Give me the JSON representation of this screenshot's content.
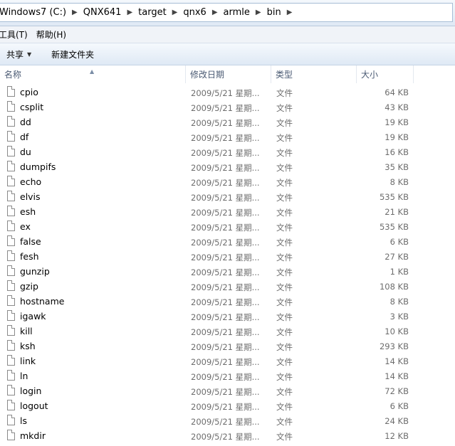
{
  "breadcrumb": [
    "Windows7 (C:)",
    "QNX641",
    "target",
    "qnx6",
    "armle",
    "bin"
  ],
  "menu": [
    "工具(T)",
    "帮助(H)"
  ],
  "toolbar": {
    "share": "共享",
    "new_folder": "新建文件夹"
  },
  "columns": {
    "name": "名称",
    "date": "修改日期",
    "type": "类型",
    "size": "大小"
  },
  "files": [
    {
      "name": "cpio",
      "date": "2009/5/21 星期...",
      "type": "文件",
      "size": "64 KB"
    },
    {
      "name": "csplit",
      "date": "2009/5/21 星期...",
      "type": "文件",
      "size": "43 KB"
    },
    {
      "name": "dd",
      "date": "2009/5/21 星期...",
      "type": "文件",
      "size": "19 KB"
    },
    {
      "name": "df",
      "date": "2009/5/21 星期...",
      "type": "文件",
      "size": "19 KB"
    },
    {
      "name": "du",
      "date": "2009/5/21 星期...",
      "type": "文件",
      "size": "16 KB"
    },
    {
      "name": "dumpifs",
      "date": "2009/5/21 星期...",
      "type": "文件",
      "size": "35 KB"
    },
    {
      "name": "echo",
      "date": "2009/5/21 星期...",
      "type": "文件",
      "size": "8 KB"
    },
    {
      "name": "elvis",
      "date": "2009/5/21 星期...",
      "type": "文件",
      "size": "535 KB"
    },
    {
      "name": "esh",
      "date": "2009/5/21 星期...",
      "type": "文件",
      "size": "21 KB"
    },
    {
      "name": "ex",
      "date": "2009/5/21 星期...",
      "type": "文件",
      "size": "535 KB"
    },
    {
      "name": "false",
      "date": "2009/5/21 星期...",
      "type": "文件",
      "size": "6 KB"
    },
    {
      "name": "fesh",
      "date": "2009/5/21 星期...",
      "type": "文件",
      "size": "27 KB"
    },
    {
      "name": "gunzip",
      "date": "2009/5/21 星期...",
      "type": "文件",
      "size": "1 KB"
    },
    {
      "name": "gzip",
      "date": "2009/5/21 星期...",
      "type": "文件",
      "size": "108 KB"
    },
    {
      "name": "hostname",
      "date": "2009/5/21 星期...",
      "type": "文件",
      "size": "8 KB"
    },
    {
      "name": "igawk",
      "date": "2009/5/21 星期...",
      "type": "文件",
      "size": "3 KB"
    },
    {
      "name": "kill",
      "date": "2009/5/21 星期...",
      "type": "文件",
      "size": "10 KB"
    },
    {
      "name": "ksh",
      "date": "2009/5/21 星期...",
      "type": "文件",
      "size": "293 KB"
    },
    {
      "name": "link",
      "date": "2009/5/21 星期...",
      "type": "文件",
      "size": "14 KB"
    },
    {
      "name": "ln",
      "date": "2009/5/21 星期...",
      "type": "文件",
      "size": "14 KB"
    },
    {
      "name": "login",
      "date": "2009/5/21 星期...",
      "type": "文件",
      "size": "72 KB"
    },
    {
      "name": "logout",
      "date": "2009/5/21 星期...",
      "type": "文件",
      "size": "6 KB"
    },
    {
      "name": "ls",
      "date": "2009/5/21 星期...",
      "type": "文件",
      "size": "24 KB"
    },
    {
      "name": "mkdir",
      "date": "2009/5/21 星期...",
      "type": "文件",
      "size": "12 KB"
    }
  ]
}
